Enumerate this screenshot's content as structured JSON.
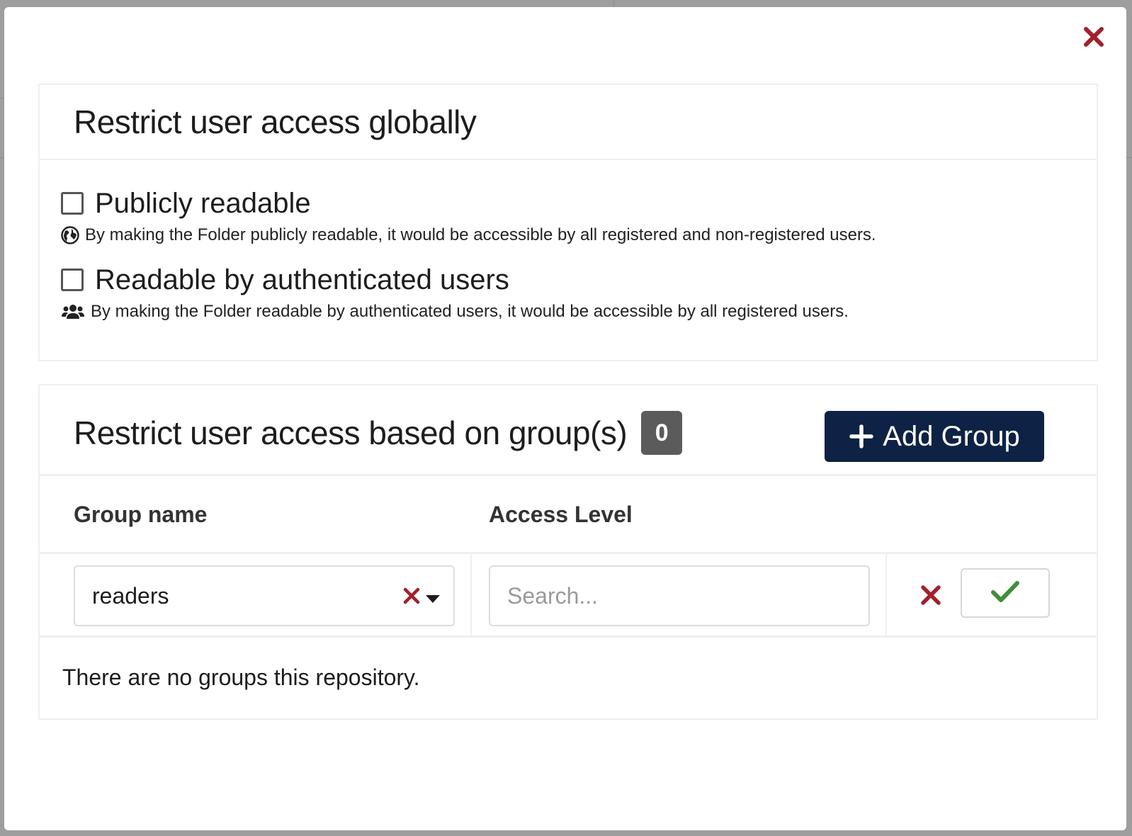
{
  "modal": {
    "close_icon": "close-icon"
  },
  "global": {
    "title": "Restrict user access globally",
    "options": [
      {
        "label": "Publicly readable",
        "checked": false,
        "help_icon": "globe-icon",
        "help": "By making the Folder publicly readable, it would be accessible by all registered and non-registered users."
      },
      {
        "label": "Readable by authenticated users",
        "checked": false,
        "help_icon": "users-icon",
        "help": "By making the Folder readable by authenticated users, it would be accessible by all registered users."
      }
    ]
  },
  "groups": {
    "title": "Restrict user access based on group(s)",
    "count": "0",
    "add_button_label": "Add Group",
    "columns": {
      "name": "Group name",
      "level": "Access Level"
    },
    "edit_row": {
      "group_value": "readers",
      "access_placeholder": "Search..."
    },
    "empty_message": "There are no groups this repository."
  },
  "colors": {
    "danger": "#a3202b",
    "success": "#3f8f3a",
    "primary": "#0d2244",
    "badge": "#5b5b5b"
  }
}
